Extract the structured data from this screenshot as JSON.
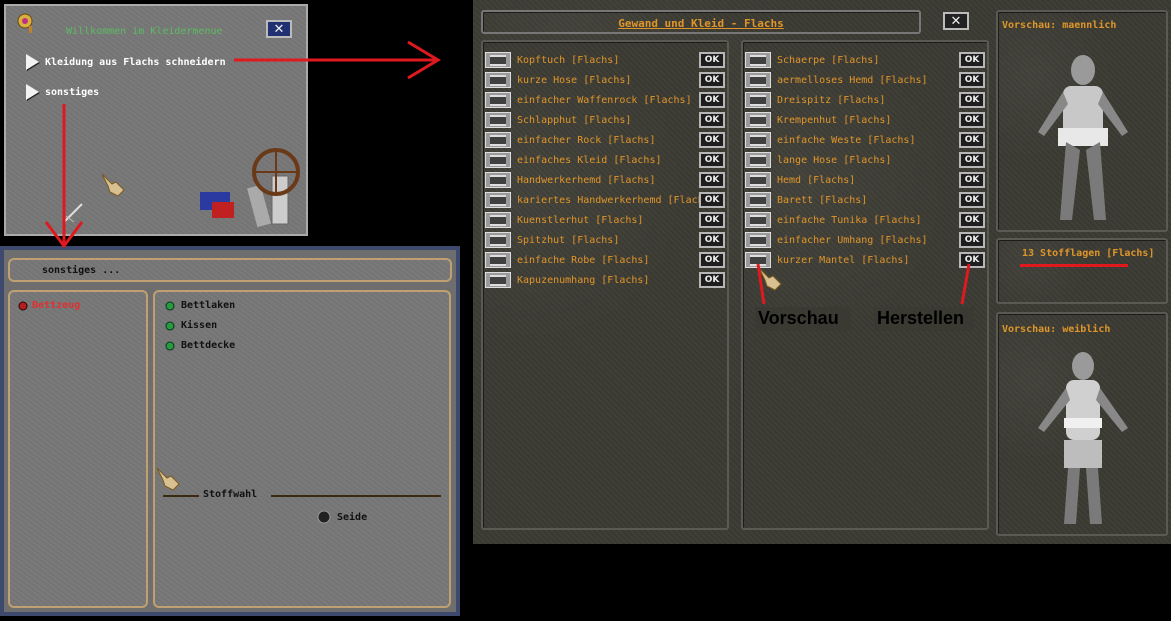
{
  "main_menu": {
    "title": "Willkommen im Kleidermenue",
    "items": [
      {
        "label": "Kleidung aus Flachs schneidern"
      },
      {
        "label": "sonstiges"
      }
    ]
  },
  "sonstiges_menu": {
    "title": "sonstiges ...",
    "categories": [
      {
        "label": "Bettzeug"
      }
    ],
    "items": [
      {
        "label": "Bettlaken"
      },
      {
        "label": "Kissen"
      },
      {
        "label": "Bettdecke"
      }
    ],
    "material_heading": "Stoffwahl",
    "material_option": "Seide"
  },
  "crafting_window": {
    "title": "Gewand und Kleid - Flachs",
    "ok_label": "OK",
    "left_items": [
      {
        "label": "Kopftuch [Flachs]"
      },
      {
        "label": "kurze Hose [Flachs]"
      },
      {
        "label": "einfacher Waffenrock [Flachs]"
      },
      {
        "label": "Schlapphut [Flachs]"
      },
      {
        "label": "einfacher Rock [Flachs]"
      },
      {
        "label": "einfaches Kleid [Flachs]"
      },
      {
        "label": "Handwerkerhemd [Flachs]"
      },
      {
        "label": "kariertes Handwerkerhemd [Flachs]"
      },
      {
        "label": "Kuenstlerhut [Flachs]"
      },
      {
        "label": "Spitzhut [Flachs]"
      },
      {
        "label": "einfache Robe [Flachs]"
      },
      {
        "label": "Kapuzenumhang [Flachs]"
      }
    ],
    "right_items": [
      {
        "label": "Schaerpe [Flachs]"
      },
      {
        "label": "aermelloses Hemd [Flachs]"
      },
      {
        "label": "Dreispitz [Flachs]"
      },
      {
        "label": "Krempenhut [Flachs]"
      },
      {
        "label": "einfache Weste [Flachs]"
      },
      {
        "label": "lange Hose [Flachs]"
      },
      {
        "label": "Hemd [Flachs]"
      },
      {
        "label": "Barett [Flachs]"
      },
      {
        "label": "einfache Tunika [Flachs]"
      },
      {
        "label": "einfacher Umhang [Flachs]"
      },
      {
        "label": "kurzer Mantel [Flachs]"
      }
    ],
    "preview_male_label": "Vorschau: maennlich",
    "preview_female_label": "Vorschau: weiblich",
    "material_count": "13 Stofflagen [Flachs]"
  },
  "annotations": {
    "preview": "Vorschau",
    "craft": "Herstellen"
  },
  "colors": {
    "item_text": "#e0952a",
    "annotation_red": "#e0191f",
    "menu_title_green": "#5dbb63",
    "category_red": "#e03030"
  }
}
